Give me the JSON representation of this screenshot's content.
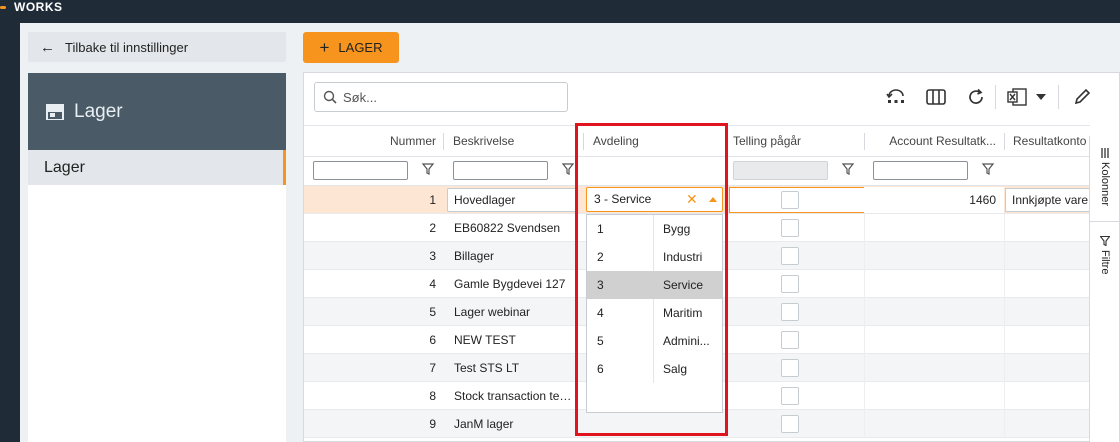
{
  "brand": {
    "name": "WORKS",
    "accent": "#f7941d",
    "dark": "#1f2c38"
  },
  "nav": {
    "back_label": "Tilbake til innstillinger",
    "panel_title": "Lager",
    "items": [
      {
        "label": "Lager"
      }
    ]
  },
  "toolbar": {
    "add_label": "LAGER",
    "search_placeholder": "Søk...",
    "icons": [
      "restore-icon",
      "columns-icon",
      "refresh-icon",
      "excel-export-icon",
      "dropdown-caret-icon",
      "edit-pencil-icon"
    ]
  },
  "columns": {
    "nummer": "Nummer",
    "beskrivelse": "Beskrivelse",
    "avdeling": "Avdeling",
    "telling": "Telling pågår",
    "account": "Account Resultatk...",
    "resultat": "Resultatkonto"
  },
  "rows": [
    {
      "num": "1",
      "desc": "Hovedlager",
      "account": "1460",
      "result": "Innkjøpte vare"
    },
    {
      "num": "2",
      "desc": "EB60822 Svendsen"
    },
    {
      "num": "3",
      "desc": "Billager"
    },
    {
      "num": "4",
      "desc": "Gamle Bygdevei 127"
    },
    {
      "num": "5",
      "desc": "Lager webinar"
    },
    {
      "num": "6",
      "desc": "NEW TEST"
    },
    {
      "num": "7",
      "desc": "Test STS LT"
    },
    {
      "num": "8",
      "desc": "Stock transaction tes..."
    },
    {
      "num": "9",
      "desc": "JanM lager"
    }
  ],
  "avdeling_editor": {
    "value": "3 - Service",
    "clear_symbol": "✕",
    "options": [
      {
        "id": "1",
        "label": "Bygg"
      },
      {
        "id": "2",
        "label": "Industri"
      },
      {
        "id": "3",
        "label": "Service"
      },
      {
        "id": "4",
        "label": "Maritim"
      },
      {
        "id": "5",
        "label": "Admini..."
      },
      {
        "id": "6",
        "label": "Salg"
      }
    ],
    "highlighted": "3"
  },
  "side_tabs": {
    "kolonner": "Kolonner",
    "filtre": "Filtre"
  }
}
